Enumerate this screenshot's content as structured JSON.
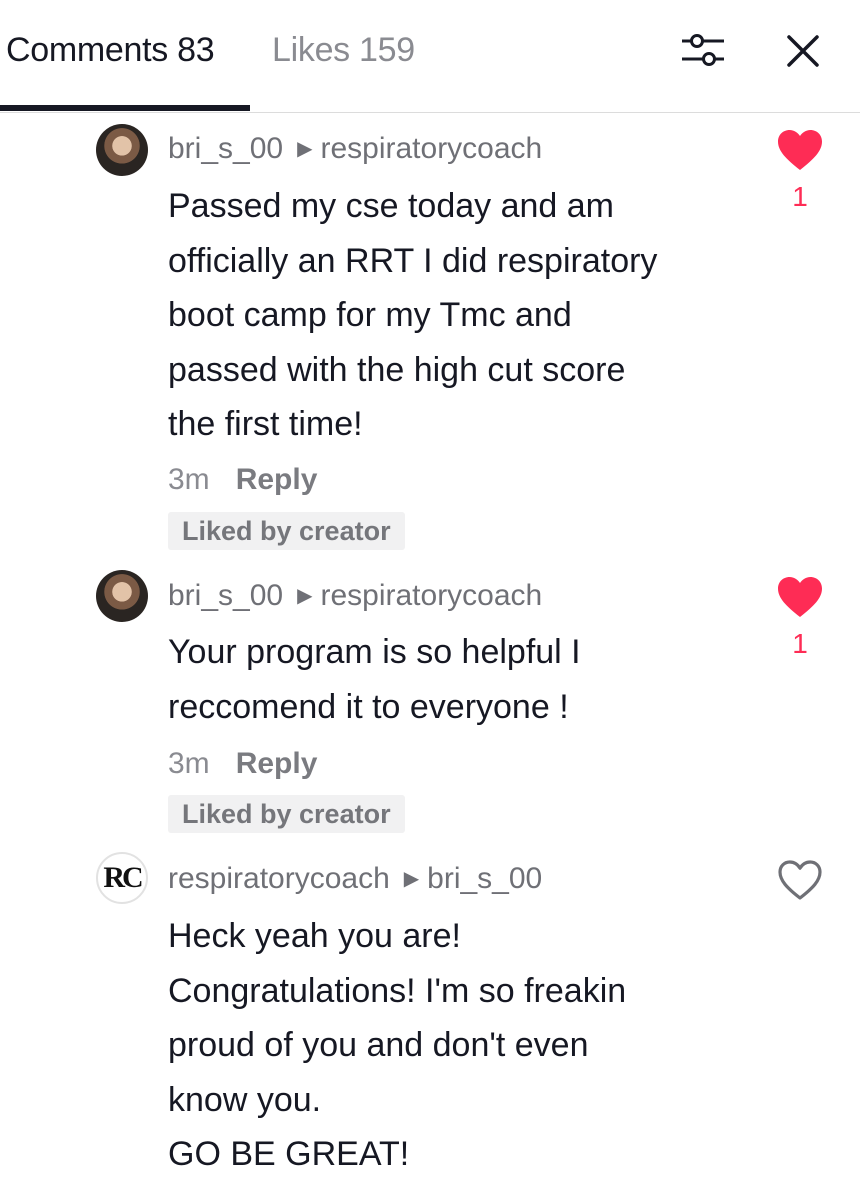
{
  "header": {
    "tabs": [
      {
        "label": "Comments 83",
        "active": true
      },
      {
        "label": "Likes 159",
        "active": false
      }
    ],
    "icons": [
      "filter-icon",
      "close-icon"
    ]
  },
  "colors": {
    "like_active": "#fe2c55",
    "text_primary": "#161823",
    "text_secondary": "#8a8b91"
  },
  "comments": [
    {
      "author": "bri_s_00",
      "reply_to": "respiratorycoach",
      "lines": [
        "Passed my cse today and am",
        "officially an RRT I did respiratory",
        "boot camp for my Tmc and",
        "passed with the high cut score",
        "the first time!"
      ],
      "time": "3m",
      "reply_label": "Reply",
      "badge": "Liked by creator",
      "liked": true,
      "like_count": "1"
    },
    {
      "author": "bri_s_00",
      "reply_to": "respiratorycoach",
      "lines": [
        "Your program is so helpful I",
        "reccomend it to everyone !"
      ],
      "time": "3m",
      "reply_label": "Reply",
      "badge": "Liked by creator",
      "liked": true,
      "like_count": "1"
    },
    {
      "author": "respiratorycoach",
      "avatar_text": "RC",
      "reply_to": "bri_s_00",
      "lines": [
        "Heck yeah you are!",
        "Congratulations! I'm so freakin",
        "proud of you and don't even",
        "know you.",
        "GO BE GREAT!"
      ],
      "liked": false
    }
  ]
}
